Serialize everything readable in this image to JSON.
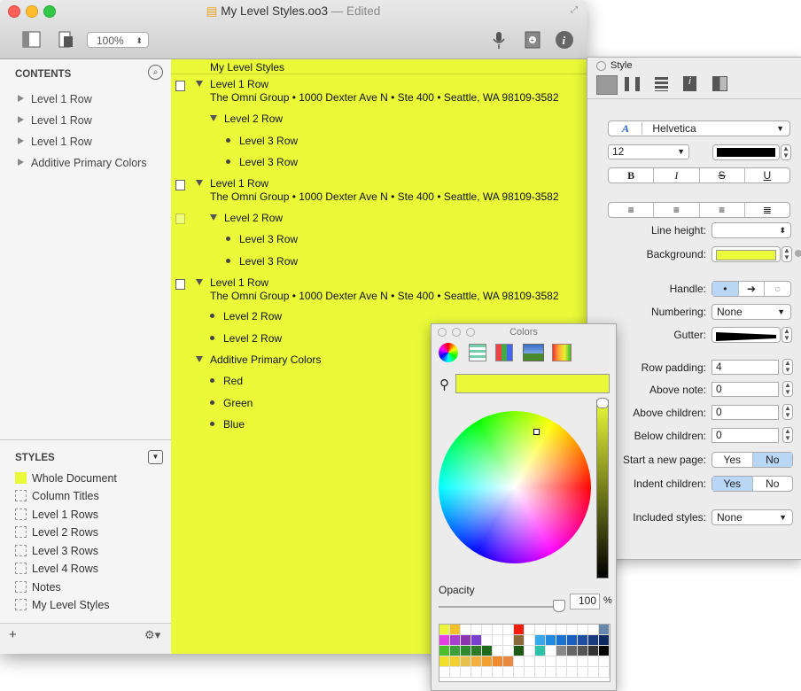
{
  "window": {
    "title": "My Level Styles.oo3",
    "status": "— Edited",
    "zoom": "100%"
  },
  "sidebar": {
    "contents_heading": "CONTENTS",
    "contents_items": [
      "Level 1 Row",
      "Level 1 Row",
      "Level 1 Row",
      "Additive Primary Colors"
    ],
    "styles_heading": "STYLES",
    "styles": [
      {
        "label": "Whole Document",
        "color": "#eafa39"
      },
      {
        "label": "Column Titles"
      },
      {
        "label": "Level 1 Rows"
      },
      {
        "label": "Level 2 Rows"
      },
      {
        "label": "Level 3 Rows"
      },
      {
        "label": "Level 4 Rows"
      },
      {
        "label": "Notes"
      },
      {
        "label": "My Level Styles"
      }
    ],
    "add_label": "+",
    "gear_label": "⚙▾"
  },
  "outline": {
    "column_title": "My Level Styles",
    "address": "The Omni Group • 1000 Dexter Ave N • Ste 400 • Seattle, WA 98109-3582",
    "level1": "Level 1 Row",
    "level2": "Level 2 Row",
    "level3": "Level 3 Row",
    "additive": "Additive Primary Colors",
    "red": "Red",
    "green": "Green",
    "blue": "Blue",
    "background": "#eafa39"
  },
  "inspector": {
    "title": "Style",
    "font": "Helvetica",
    "font_size": "12",
    "bold": "B",
    "italic": "I",
    "strike": "S",
    "underline": "U",
    "line_height_label": "Line height:",
    "background_label": "Background:",
    "handle_label": "Handle:",
    "numbering_label": "Numbering:",
    "numbering_value": "None",
    "gutter_label": "Gutter:",
    "row_padding_label": "Row padding:",
    "row_padding_value": "4",
    "above_note_label": "Above note:",
    "above_note_value": "0",
    "above_children_label": "Above children:",
    "above_children_value": "0",
    "below_children_label": "Below children:",
    "below_children_value": "0",
    "new_page_label": "Start a new page:",
    "indent_label": "Indent children:",
    "yes": "Yes",
    "no": "No",
    "included_label": "Included styles:",
    "included_value": "None"
  },
  "colors": {
    "title": "Colors",
    "opacity_label": "Opacity",
    "opacity_value": "100",
    "percent": "%",
    "current_color": "#eafa39",
    "palette": [
      "#e9f53a",
      "#f2c02a",
      "#fff",
      "#fff",
      "#fff",
      "#fff",
      "#fff",
      "#f21d0c",
      "#fff",
      "#fff",
      "#fff",
      "#fff",
      "#fff",
      "#fff",
      "#fff",
      "#6688aa",
      "#e441e4",
      "#a93fd0",
      "#8c35b0",
      "#7a3fcf",
      "#fff",
      "#fff",
      "#fff",
      "#8a6a3a",
      "#fff",
      "#38a8e8",
      "#1e8be0",
      "#1a73d0",
      "#1a5fbf",
      "#1f4fa0",
      "#1a3a80",
      "#0f2a60",
      "#4cbf2c",
      "#3ca03a",
      "#2f8a30",
      "#2e7a2a",
      "#1f6a1c",
      "#fff",
      "#fff",
      "#1e5a14",
      "#fff",
      "#2ec2a8",
      "#fff",
      "#888",
      "#666",
      "#555",
      "#333",
      "#000",
      "#f0e02a",
      "#f2d030",
      "#e8c050",
      "#f2b040",
      "#f2a030",
      "#f08a30",
      "#e88a40",
      "#fff",
      "#fff",
      "#fff",
      "#fff",
      "#fff",
      "#fff",
      "#fff",
      "#fff",
      "#fff",
      "#fff",
      "#fff",
      "#fff",
      "#fff",
      "#fff",
      "#fff",
      "#fff",
      "#fff",
      "#fff",
      "#fff",
      "#fff",
      "#fff",
      "#fff",
      "#fff",
      "#fff",
      "#fff"
    ]
  }
}
